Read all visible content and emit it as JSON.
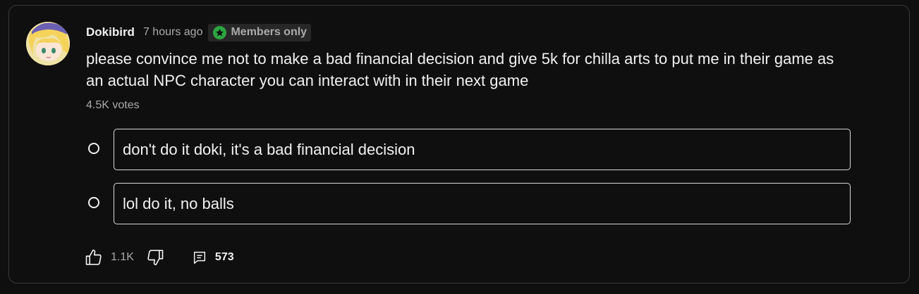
{
  "post": {
    "author": "Dokibird",
    "time": "7 hours ago",
    "badge": "Members only",
    "question": "please convince me not to make a bad financial decision and give 5k for chilla arts to put me in their game as an actual NPC character you can interact with in their next game",
    "votes": "4.5K votes"
  },
  "options": [
    {
      "label": "don't do it doki, it's a bad financial decision"
    },
    {
      "label": "lol do it, no balls"
    }
  ],
  "actions": {
    "like_count": "1.1K",
    "comment_count": "573"
  },
  "icons": [
    "avatar",
    "star-icon",
    "radio-icon",
    "thumbs-up-icon",
    "thumbs-down-icon",
    "comment-icon"
  ],
  "colors": {
    "background": "#0f0f0f",
    "border": "#3a3a3a",
    "text": "#f1f1f1",
    "muted": "#aaaaaa",
    "badge_bg": "#272727",
    "star_green": "#2ba640"
  }
}
